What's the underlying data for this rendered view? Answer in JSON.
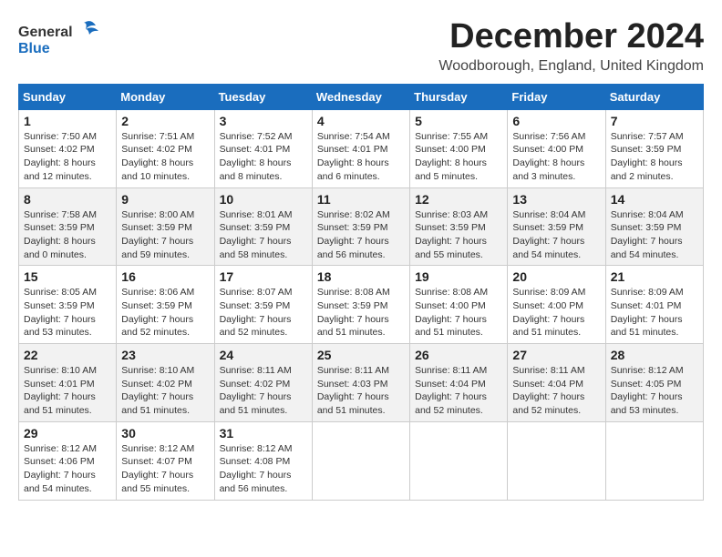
{
  "logo": {
    "general": "General",
    "blue": "Blue"
  },
  "title": "December 2024",
  "location": "Woodborough, England, United Kingdom",
  "days_of_week": [
    "Sunday",
    "Monday",
    "Tuesday",
    "Wednesday",
    "Thursday",
    "Friday",
    "Saturday"
  ],
  "weeks": [
    [
      {
        "day": "1",
        "info": "Sunrise: 7:50 AM\nSunset: 4:02 PM\nDaylight: 8 hours\nand 12 minutes."
      },
      {
        "day": "2",
        "info": "Sunrise: 7:51 AM\nSunset: 4:02 PM\nDaylight: 8 hours\nand 10 minutes."
      },
      {
        "day": "3",
        "info": "Sunrise: 7:52 AM\nSunset: 4:01 PM\nDaylight: 8 hours\nand 8 minutes."
      },
      {
        "day": "4",
        "info": "Sunrise: 7:54 AM\nSunset: 4:01 PM\nDaylight: 8 hours\nand 6 minutes."
      },
      {
        "day": "5",
        "info": "Sunrise: 7:55 AM\nSunset: 4:00 PM\nDaylight: 8 hours\nand 5 minutes."
      },
      {
        "day": "6",
        "info": "Sunrise: 7:56 AM\nSunset: 4:00 PM\nDaylight: 8 hours\nand 3 minutes."
      },
      {
        "day": "7",
        "info": "Sunrise: 7:57 AM\nSunset: 3:59 PM\nDaylight: 8 hours\nand 2 minutes."
      }
    ],
    [
      {
        "day": "8",
        "info": "Sunrise: 7:58 AM\nSunset: 3:59 PM\nDaylight: 8 hours\nand 0 minutes."
      },
      {
        "day": "9",
        "info": "Sunrise: 8:00 AM\nSunset: 3:59 PM\nDaylight: 7 hours\nand 59 minutes."
      },
      {
        "day": "10",
        "info": "Sunrise: 8:01 AM\nSunset: 3:59 PM\nDaylight: 7 hours\nand 58 minutes."
      },
      {
        "day": "11",
        "info": "Sunrise: 8:02 AM\nSunset: 3:59 PM\nDaylight: 7 hours\nand 56 minutes."
      },
      {
        "day": "12",
        "info": "Sunrise: 8:03 AM\nSunset: 3:59 PM\nDaylight: 7 hours\nand 55 minutes."
      },
      {
        "day": "13",
        "info": "Sunrise: 8:04 AM\nSunset: 3:59 PM\nDaylight: 7 hours\nand 54 minutes."
      },
      {
        "day": "14",
        "info": "Sunrise: 8:04 AM\nSunset: 3:59 PM\nDaylight: 7 hours\nand 54 minutes."
      }
    ],
    [
      {
        "day": "15",
        "info": "Sunrise: 8:05 AM\nSunset: 3:59 PM\nDaylight: 7 hours\nand 53 minutes."
      },
      {
        "day": "16",
        "info": "Sunrise: 8:06 AM\nSunset: 3:59 PM\nDaylight: 7 hours\nand 52 minutes."
      },
      {
        "day": "17",
        "info": "Sunrise: 8:07 AM\nSunset: 3:59 PM\nDaylight: 7 hours\nand 52 minutes."
      },
      {
        "day": "18",
        "info": "Sunrise: 8:08 AM\nSunset: 3:59 PM\nDaylight: 7 hours\nand 51 minutes."
      },
      {
        "day": "19",
        "info": "Sunrise: 8:08 AM\nSunset: 4:00 PM\nDaylight: 7 hours\nand 51 minutes."
      },
      {
        "day": "20",
        "info": "Sunrise: 8:09 AM\nSunset: 4:00 PM\nDaylight: 7 hours\nand 51 minutes."
      },
      {
        "day": "21",
        "info": "Sunrise: 8:09 AM\nSunset: 4:01 PM\nDaylight: 7 hours\nand 51 minutes."
      }
    ],
    [
      {
        "day": "22",
        "info": "Sunrise: 8:10 AM\nSunset: 4:01 PM\nDaylight: 7 hours\nand 51 minutes."
      },
      {
        "day": "23",
        "info": "Sunrise: 8:10 AM\nSunset: 4:02 PM\nDaylight: 7 hours\nand 51 minutes."
      },
      {
        "day": "24",
        "info": "Sunrise: 8:11 AM\nSunset: 4:02 PM\nDaylight: 7 hours\nand 51 minutes."
      },
      {
        "day": "25",
        "info": "Sunrise: 8:11 AM\nSunset: 4:03 PM\nDaylight: 7 hours\nand 51 minutes."
      },
      {
        "day": "26",
        "info": "Sunrise: 8:11 AM\nSunset: 4:04 PM\nDaylight: 7 hours\nand 52 minutes."
      },
      {
        "day": "27",
        "info": "Sunrise: 8:11 AM\nSunset: 4:04 PM\nDaylight: 7 hours\nand 52 minutes."
      },
      {
        "day": "28",
        "info": "Sunrise: 8:12 AM\nSunset: 4:05 PM\nDaylight: 7 hours\nand 53 minutes."
      }
    ],
    [
      {
        "day": "29",
        "info": "Sunrise: 8:12 AM\nSunset: 4:06 PM\nDaylight: 7 hours\nand 54 minutes."
      },
      {
        "day": "30",
        "info": "Sunrise: 8:12 AM\nSunset: 4:07 PM\nDaylight: 7 hours\nand 55 minutes."
      },
      {
        "day": "31",
        "info": "Sunrise: 8:12 AM\nSunset: 4:08 PM\nDaylight: 7 hours\nand 56 minutes."
      },
      {
        "day": "",
        "info": ""
      },
      {
        "day": "",
        "info": ""
      },
      {
        "day": "",
        "info": ""
      },
      {
        "day": "",
        "info": ""
      }
    ]
  ]
}
